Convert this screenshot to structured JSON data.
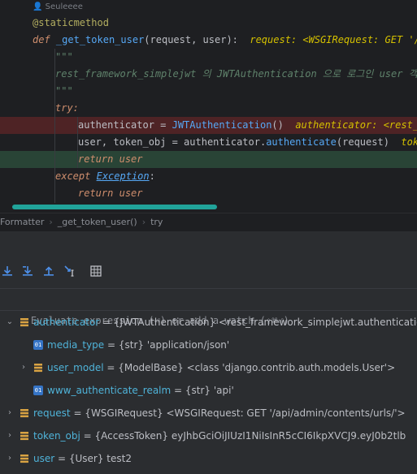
{
  "editor": {
    "author": "Seuleeee",
    "line_decorator": "@staticmethod",
    "line_def_kw": "def",
    "line_def_name": "_get_token_user",
    "line_def_params": "(request, user):",
    "line_def_hint": "request: <WSGIRequest: GET '/api",
    "docstring_open": "\"\"\"",
    "docstring_text": "rest_framework_simplejwt 의 JWTAuthentication 으로 로그인 user 객체를",
    "docstring_close": "\"\"\"",
    "try_kw": "try:",
    "auth_line_code1": "authenticator = ",
    "auth_line_cls": "JWTAuthentication",
    "auth_line_code2": "()",
    "auth_line_hint": "authenticator: <rest_fr",
    "user_line_code1": "user, token_obj = authenticator.",
    "user_line_fn": "authenticate",
    "user_line_code2": "(request)",
    "user_line_hint": "token",
    "return_kw": "return",
    "return_val": "user",
    "except_kw": "except",
    "except_cls": "Exception",
    "except_colon": ":",
    "return2_kw": "return",
    "return2_val": "user"
  },
  "breadcrumb": {
    "item1": "Formatter",
    "item2": "_get_token_user()",
    "item3": "try",
    "sep": "›"
  },
  "debugger": {
    "evaluate_placeholder": "Evaluate expression (⏎) or add a watch (⇧⌘⏎)",
    "variables": [
      {
        "name": "authenticator",
        "value": " = {JWTAuthentication} <rest_framework_simplejwt.authentication"
      },
      {
        "name": "media_type",
        "value": " = {str} 'application/json'"
      },
      {
        "name": "user_model",
        "value": " = {ModelBase} <class 'django.contrib.auth.models.User'>"
      },
      {
        "name": "www_authenticate_realm",
        "value": " = {str} 'api'"
      },
      {
        "name": "request",
        "value": " = {WSGIRequest} <WSGIRequest: GET '/api/admin/contents/urls/'>"
      },
      {
        "name": "token_obj",
        "value": " = {AccessToken} eyJhbGciOiJIUzI1NiIsInR5cCI6IkpXVCJ9.eyJ0b2tlb"
      },
      {
        "name": "user",
        "value": " = {User} test2"
      }
    ],
    "field_icon_label": "01"
  },
  "colors": {
    "editor_bg": "#1e1f22",
    "panel_bg": "#2b2d30",
    "breakpoint_line": "#4e2325",
    "current_line": "#294436",
    "accent_teal": "#21a39a"
  }
}
